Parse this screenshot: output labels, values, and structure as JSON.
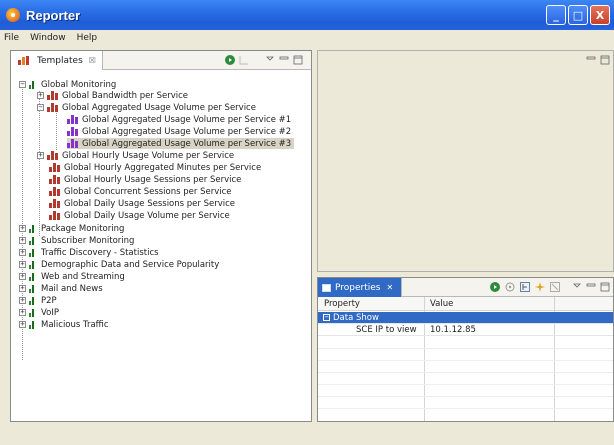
{
  "window": {
    "title": "Reporter",
    "minimize": "_",
    "maximize": "□",
    "close": "X"
  },
  "menu": {
    "items": [
      "File",
      "Window",
      "Help"
    ]
  },
  "templates_view": {
    "tab_label": "Templates",
    "close_glyph": "☒",
    "tree": {
      "global_monitoring": "Global Monitoring",
      "global_bandwidth": "Global Bandwidth per Service",
      "global_aggregated": "Global Aggregated Usage Volume per Service",
      "global_aggregated_1": "Global Aggregated Usage Volume per Service #1",
      "global_aggregated_2": "Global Aggregated Usage Volume per Service #2",
      "global_aggregated_3": "Global Aggregated Usage Volume per Service #3",
      "global_hourly_usage": "Global Hourly Usage Volume per Service",
      "global_hourly_minutes": "Global Hourly Aggregated Minutes per Service",
      "global_hourly_sessions": "Global Hourly Usage Sessions per Service",
      "global_concurrent": "Global Concurrent Sessions per Service",
      "global_daily_sessions": "Global Daily Usage Sessions per Service",
      "global_daily_volume": "Global Daily Usage Volume per Service",
      "package_monitoring": "Package Monitoring",
      "subscriber_monitoring": "Subscriber Monitoring",
      "traffic_discovery": "Traffic Discovery - Statistics",
      "demographic": "Demographic Data and Service Popularity",
      "web_streaming": "Web and Streaming",
      "mail_news": "Mail and News",
      "p2p": "P2P",
      "voip": "VoIP",
      "malicious": "Malicious Traffic"
    }
  },
  "properties_view": {
    "tab_label": "Properties",
    "close_glyph": "✕",
    "columns": {
      "property": "Property",
      "value": "Value"
    },
    "group_label": "Data Show",
    "rows": [
      {
        "property": "SCE IP to view",
        "value": "10.1.12.85"
      }
    ]
  },
  "colors": {
    "title_bar": "#2a6de6",
    "selection": "#316ac5",
    "tab_active": "#316ac5"
  }
}
